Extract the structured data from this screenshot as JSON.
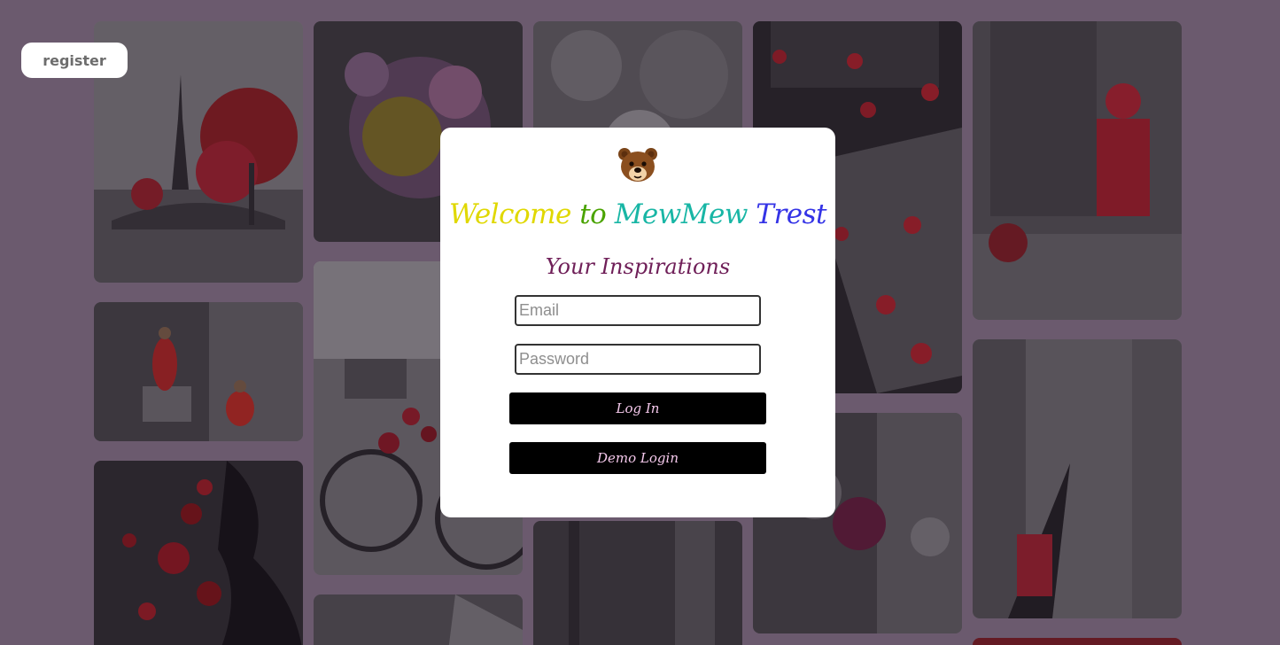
{
  "register_button": {
    "label": "register"
  },
  "modal": {
    "bear_icon": "bear-icon",
    "welcome_words": [
      {
        "text": "Welcome ",
        "color": "#e0d800"
      },
      {
        "text": "to ",
        "color": "#4aa300"
      },
      {
        "text": "MewMew ",
        "color": "#18b6a5"
      },
      {
        "text": "Trest",
        "color": "#3433e6"
      }
    ],
    "subtitle": "Your Inspirations",
    "email_placeholder": "Email",
    "password_placeholder": "Password",
    "login_label": "Log In",
    "demo_label": "Demo Login"
  },
  "colors": {
    "backdrop": "#6b5a6e",
    "button_bg": "#000000",
    "button_text": "#f5c9ec",
    "subtitle": "#6f1f58"
  }
}
